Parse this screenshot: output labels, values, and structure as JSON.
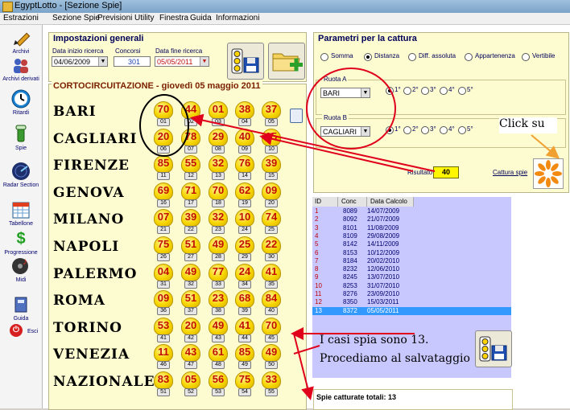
{
  "window": {
    "title": "EgyptLotto - [Sezione Spie]"
  },
  "menu": [
    "Estrazioni",
    "Sezione Spie",
    "Previsioni",
    "Utility",
    "Finestra",
    "Guida",
    "Informazioni"
  ],
  "sidebar": [
    {
      "label": "Archivi",
      "icon": "pencil-icon"
    },
    {
      "label": "Archivi derivati",
      "icon": "people-icon"
    },
    {
      "label": "Ritardi",
      "icon": "clock-icon"
    },
    {
      "label": "Spie",
      "icon": "flashlight-icon"
    },
    {
      "label": "Radar Section",
      "icon": "radar-icon"
    },
    {
      "label": "Tabellone",
      "icon": "calendar-icon"
    },
    {
      "label": "Progressione",
      "icon": "dollar-icon"
    },
    {
      "label": "Midi",
      "icon": "music-icon"
    },
    {
      "label": "Guida",
      "icon": "book-icon"
    },
    {
      "label": "Esci",
      "icon": "exit-icon"
    }
  ],
  "impostazioni": {
    "legend": "Impostazioni generali",
    "start_label": "Data inizio ricerca",
    "start_value": "04/06/2009",
    "concorsi_label": "Concorsi",
    "concorsi_value": "301",
    "end_label": "Data fine ricerca",
    "end_value": "05/05/2011"
  },
  "grid": {
    "title": "CORTOCIRCUITAZIONE - giovedì 05 maggio 2011",
    "rows": [
      {
        "wheel": "BARI",
        "numbers": [
          "70",
          "44",
          "01",
          "38",
          "37"
        ],
        "indices": [
          "01",
          "02",
          "03",
          "04",
          "05"
        ]
      },
      {
        "wheel": "CAGLIARI",
        "numbers": [
          "20",
          "78",
          "29",
          "40",
          "05"
        ],
        "indices": [
          "06",
          "07",
          "08",
          "09",
          "10"
        ]
      },
      {
        "wheel": "FIRENZE",
        "numbers": [
          "85",
          "55",
          "32",
          "76",
          "39"
        ],
        "indices": [
          "11",
          "12",
          "13",
          "14",
          "15"
        ]
      },
      {
        "wheel": "GENOVA",
        "numbers": [
          "69",
          "71",
          "70",
          "62",
          "09"
        ],
        "indices": [
          "16",
          "17",
          "18",
          "19",
          "20"
        ]
      },
      {
        "wheel": "MILANO",
        "numbers": [
          "07",
          "39",
          "32",
          "10",
          "74"
        ],
        "indices": [
          "21",
          "22",
          "23",
          "24",
          "25"
        ]
      },
      {
        "wheel": "NAPOLI",
        "numbers": [
          "75",
          "51",
          "49",
          "25",
          "22"
        ],
        "indices": [
          "26",
          "27",
          "28",
          "29",
          "30"
        ]
      },
      {
        "wheel": "PALERMO",
        "numbers": [
          "04",
          "49",
          "77",
          "24",
          "41"
        ],
        "indices": [
          "31",
          "32",
          "33",
          "34",
          "35"
        ]
      },
      {
        "wheel": "ROMA",
        "numbers": [
          "09",
          "51",
          "23",
          "68",
          "84"
        ],
        "indices": [
          "36",
          "37",
          "38",
          "39",
          "40"
        ]
      },
      {
        "wheel": "TORINO",
        "numbers": [
          "53",
          "20",
          "49",
          "41",
          "70"
        ],
        "indices": [
          "41",
          "42",
          "43",
          "44",
          "45"
        ]
      },
      {
        "wheel": "VENEZIA",
        "numbers": [
          "11",
          "43",
          "61",
          "85",
          "49"
        ],
        "indices": [
          "46",
          "47",
          "48",
          "49",
          "50"
        ]
      },
      {
        "wheel": "NAZIONALE",
        "numbers": [
          "83",
          "05",
          "56",
          "75",
          "33"
        ],
        "indices": [
          "51",
          "52",
          "53",
          "54",
          "55"
        ]
      }
    ]
  },
  "params": {
    "legend": "Parametri per la cattura",
    "modes": [
      "Somma",
      "Distanza",
      "Diff. assoluta",
      "Appartenenza",
      "Vertibile"
    ],
    "selected_mode": 1,
    "ruota_a_label": "Ruota A",
    "ruota_a_value": "BARI",
    "ruota_b_label": "Ruota B",
    "ruota_b_value": "CAGLIARI",
    "positions": [
      "1°",
      "2°",
      "3°",
      "4°",
      "5°"
    ],
    "risultato_label": "Risultato",
    "risultato_value": "40",
    "cattura_link": "Cattura spie"
  },
  "table": {
    "headers": [
      "ID",
      "Conc",
      "Data Calcolo"
    ],
    "rows": [
      [
        "1",
        "8089",
        "14/07/2009"
      ],
      [
        "2",
        "8092",
        "21/07/2009"
      ],
      [
        "3",
        "8101",
        "11/08/2009"
      ],
      [
        "4",
        "8109",
        "29/08/2009"
      ],
      [
        "5",
        "8142",
        "14/11/2009"
      ],
      [
        "6",
        "8153",
        "10/12/2009"
      ],
      [
        "7",
        "8184",
        "20/02/2010"
      ],
      [
        "8",
        "8232",
        "12/06/2010"
      ],
      [
        "9",
        "8245",
        "13/07/2010"
      ],
      [
        "10",
        "8253",
        "31/07/2010"
      ],
      [
        "11",
        "8276",
        "23/09/2010"
      ],
      [
        "12",
        "8350",
        "15/03/2011"
      ],
      [
        "13",
        "8372",
        "05/05/2011"
      ]
    ],
    "selected_row": 12
  },
  "spie_totali": "Spie catturate totali: 13",
  "annotations": {
    "click_su": "Click su",
    "note_line1": "I casi spia sono 13.",
    "note_line2": "Procediamo al salvataggio"
  },
  "colors": {
    "panel": "#fdfbd0",
    "bulb": "#f7d500",
    "number": "#c21000",
    "arrow": "#e0001b",
    "callout_arrow": "#f0a030",
    "table_bg": "#c8c8ff",
    "selected": "#3399ff"
  }
}
